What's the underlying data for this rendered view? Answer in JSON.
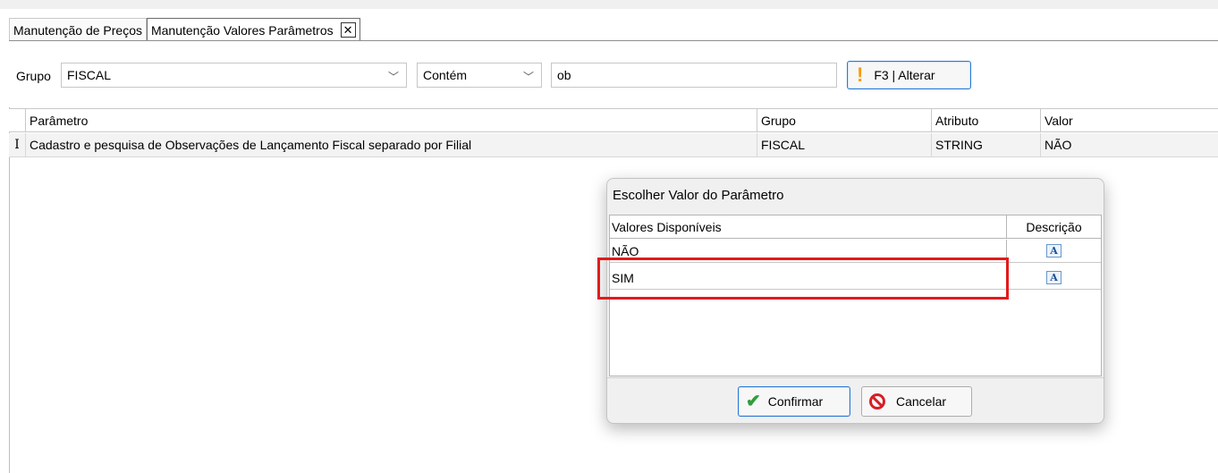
{
  "tabs": [
    {
      "label": "Manutenção de Preços",
      "active": false
    },
    {
      "label": "Manutenção Valores Parâmetros",
      "active": true
    }
  ],
  "filter": {
    "grupo_label": "Grupo",
    "grupo_value": "FISCAL",
    "operator_value": "Contém",
    "search_value": "ob",
    "f3_button_label": "F3 | Alterar"
  },
  "grid": {
    "columns": [
      "Parâmetro",
      "Grupo",
      "Atributo",
      "Valor"
    ],
    "rows": [
      {
        "indicator": "I",
        "parametro": "Cadastro e pesquisa de Observações de Lançamento Fiscal separado por Filial",
        "grupo": "FISCAL",
        "atributo": "STRING",
        "valor": "NÃO"
      }
    ]
  },
  "dialog": {
    "title": "Escolher Valor do Parâmetro",
    "columns": [
      "Valores Disponíveis",
      "Descrição"
    ],
    "rows": [
      {
        "value": "NÃO",
        "desc_icon": "A"
      },
      {
        "value": "SIM",
        "desc_icon": "A"
      }
    ],
    "confirm_label": "Confirmar",
    "cancel_label": "Cancelar"
  },
  "colors": {
    "accent_border": "#2a7bd5",
    "highlight": "#e21b1b",
    "warning_icon": "#f39c12",
    "confirm_icon": "#2e9e3a",
    "cancel_icon": "#d61f26"
  },
  "icons": {
    "tab_close": "✕",
    "chevron": "﹀",
    "warning": "!",
    "check": "✔"
  }
}
